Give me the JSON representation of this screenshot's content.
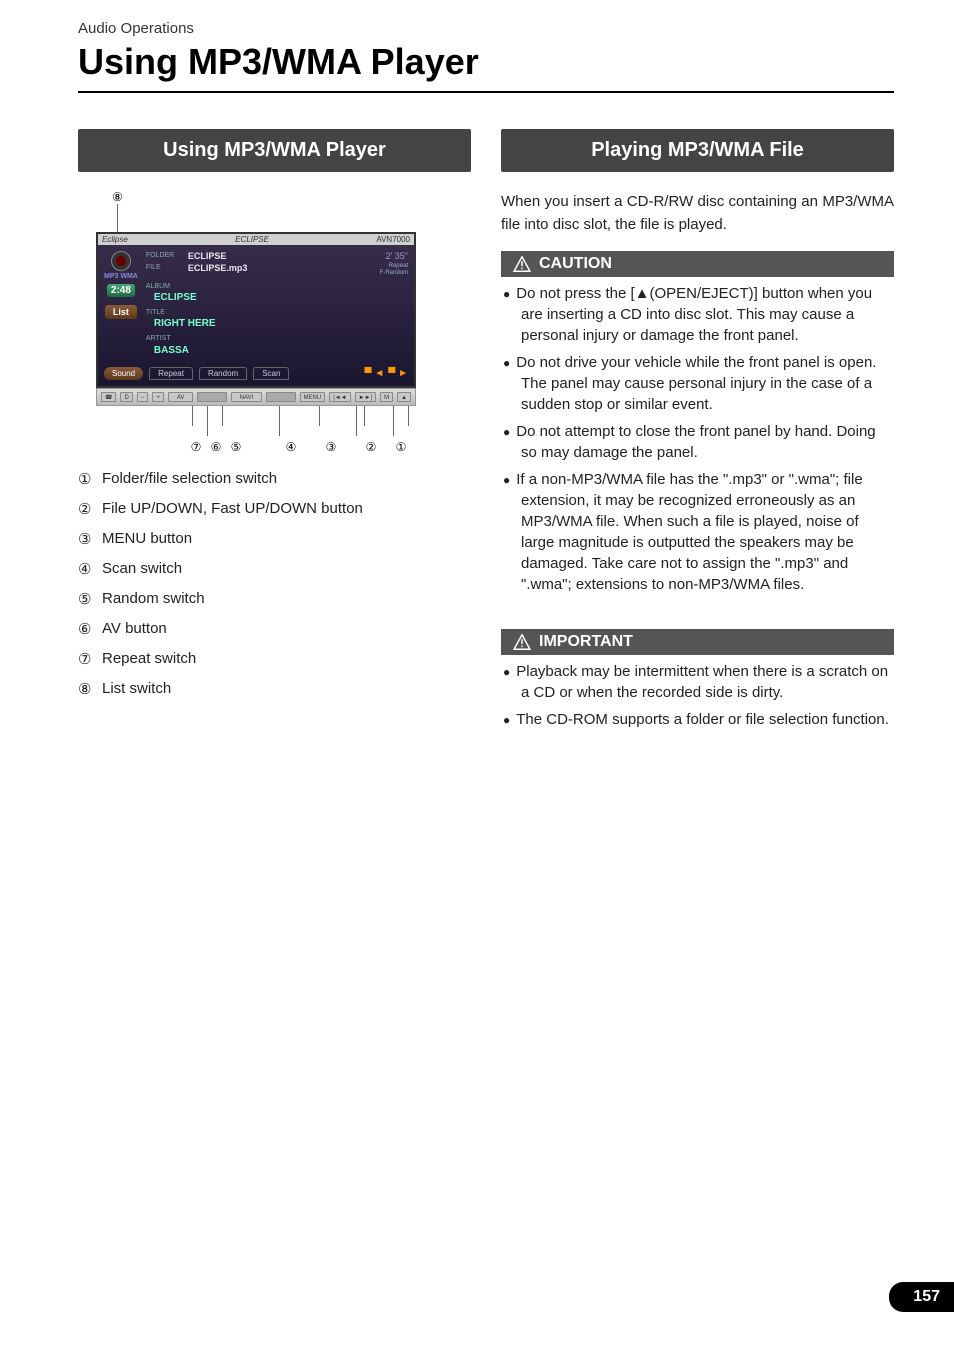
{
  "breadcrumb": "Audio Operations",
  "title": "Using MP3/WMA Player",
  "left": {
    "header": "Using MP3/WMA Player",
    "callout8": "⑧",
    "screen": {
      "brand_left": "Eclipse",
      "brand_center": "ECLIPSE",
      "model": "AVN7000",
      "folder_label": "FOLDER",
      "folder_value": "ECLIPSE",
      "file_label": "FILE",
      "file_value": "ECLIPSE.mp3",
      "time_top": "2' 35\"",
      "repeat_label": "Repeat",
      "frandom_label": "F-Random",
      "badge": "MP3 WMA",
      "elapsed": "2:48",
      "list_btn": "List",
      "album_label": "ALBUM",
      "album_value": "ECLIPSE",
      "title_label": "TITLE",
      "title_value": "RIGHT HERE",
      "artist_label": "ARTIST",
      "artist_value": "BASSA",
      "sound_btn": "Sound",
      "repeat_tab": "Repeat",
      "random_tab": "Random",
      "scan_tab": "Scan",
      "folder_prev": "▀ ◄",
      "folder_next": "▀ ►"
    },
    "bezel": {
      "phone": "☎",
      "d": "D",
      "minus": "−",
      "plus": "+",
      "av": "AV",
      "navi": "NAVI",
      "menu": "MENU",
      "prev": "|◄◄",
      "next": "►►|",
      "m": "M",
      "eject": "▲"
    },
    "callouts": {
      "c7": "⑦",
      "c6": "⑥",
      "c5": "⑤",
      "c4": "④",
      "c3": "③",
      "c2": "②",
      "c1": "①"
    },
    "legend": [
      {
        "num": "①",
        "text": "Folder/file selection switch"
      },
      {
        "num": "②",
        "text": "File UP/DOWN, Fast UP/DOWN button"
      },
      {
        "num": "③",
        "text": "MENU button"
      },
      {
        "num": "④",
        "text": "Scan switch"
      },
      {
        "num": "⑤",
        "text": "Random switch"
      },
      {
        "num": "⑥",
        "text": "AV button"
      },
      {
        "num": "⑦",
        "text": "Repeat switch"
      },
      {
        "num": "⑧",
        "text": "List switch"
      }
    ]
  },
  "right": {
    "header": "Playing MP3/WMA File",
    "intro": "When you insert a CD-R/RW disc containing an MP3/WMA file into disc slot, the file is played.",
    "caution_title": "CAUTION",
    "caution_items": [
      "Do not press the [▲(OPEN/EJECT)] button when you are inserting a CD into disc slot. This may cause a personal injury or damage the front panel.",
      "Do not drive your vehicle while the front panel is open. The panel may cause personal injury in the case of a sudden stop or similar event.",
      "Do not attempt to close the front panel by hand. Doing so may damage the panel.",
      "If a non-MP3/WMA file has the \".mp3\" or \".wma\"; file extension, it may be recognized erroneously as an MP3/WMA file. When such a file is played, noise of large magnitude is outputted the speakers may be damaged. Take care not to assign the \".mp3\" and \".wma\"; extensions to non-MP3/WMA files."
    ],
    "important_title": "IMPORTANT",
    "important_items": [
      "Playback may be intermittent when there is a scratch on a CD or when the recorded side is dirty.",
      "The CD-ROM supports a folder or file selection function."
    ]
  },
  "page_number": "157"
}
